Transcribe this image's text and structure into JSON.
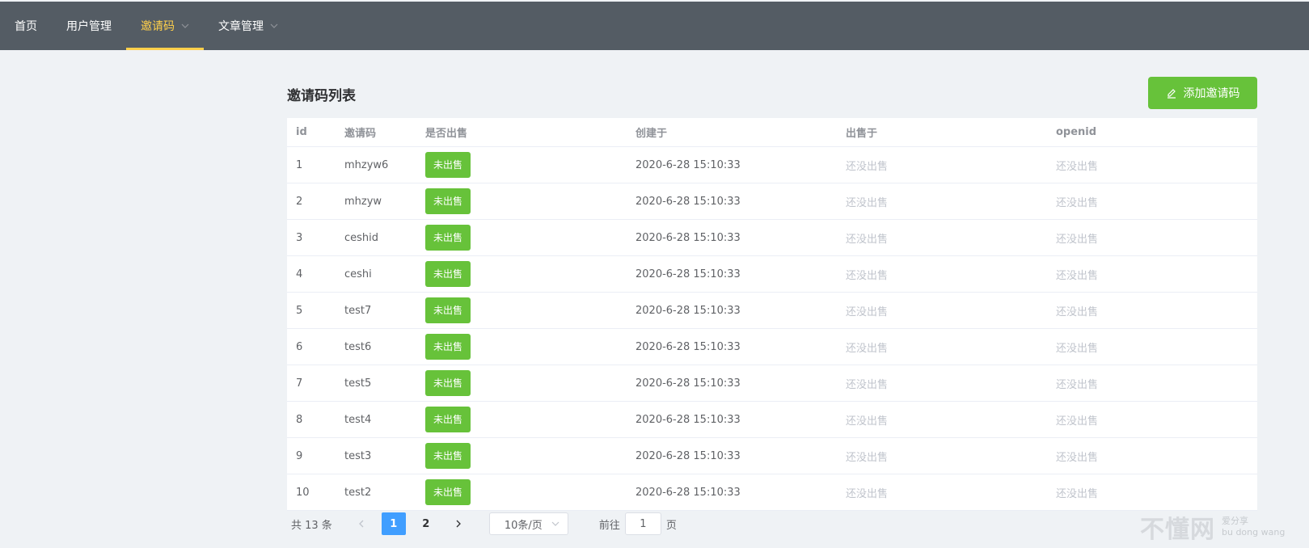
{
  "nav": {
    "items": [
      {
        "label": "首页",
        "active": false,
        "dropdown": false
      },
      {
        "label": "用户管理",
        "active": false,
        "dropdown": false
      },
      {
        "label": "邀请码",
        "active": true,
        "dropdown": true
      },
      {
        "label": "文章管理",
        "active": false,
        "dropdown": true
      }
    ]
  },
  "page": {
    "title": "邀请码列表",
    "add_button": "添加邀请码",
    "add_icon": "edit-icon"
  },
  "table": {
    "columns": [
      "id",
      "邀请码",
      "是否出售",
      "创建于",
      "出售于",
      "openid"
    ],
    "rows": [
      {
        "id": "1",
        "code": "mhzyw6",
        "status": "未出售",
        "created": "2020-6-28 15:10:33",
        "sold_at": "还没出售",
        "openid": "还没出售"
      },
      {
        "id": "2",
        "code": "mhzyw",
        "status": "未出售",
        "created": "2020-6-28 15:10:33",
        "sold_at": "还没出售",
        "openid": "还没出售"
      },
      {
        "id": "3",
        "code": "ceshid",
        "status": "未出售",
        "created": "2020-6-28 15:10:33",
        "sold_at": "还没出售",
        "openid": "还没出售"
      },
      {
        "id": "4",
        "code": "ceshi",
        "status": "未出售",
        "created": "2020-6-28 15:10:33",
        "sold_at": "还没出售",
        "openid": "还没出售"
      },
      {
        "id": "5",
        "code": "test7",
        "status": "未出售",
        "created": "2020-6-28 15:10:33",
        "sold_at": "还没出售",
        "openid": "还没出售"
      },
      {
        "id": "6",
        "code": "test6",
        "status": "未出售",
        "created": "2020-6-28 15:10:33",
        "sold_at": "还没出售",
        "openid": "还没出售"
      },
      {
        "id": "7",
        "code": "test5",
        "status": "未出售",
        "created": "2020-6-28 15:10:33",
        "sold_at": "还没出售",
        "openid": "还没出售"
      },
      {
        "id": "8",
        "code": "test4",
        "status": "未出售",
        "created": "2020-6-28 15:10:33",
        "sold_at": "还没出售",
        "openid": "还没出售"
      },
      {
        "id": "9",
        "code": "test3",
        "status": "未出售",
        "created": "2020-6-28 15:10:33",
        "sold_at": "还没出售",
        "openid": "还没出售"
      },
      {
        "id": "10",
        "code": "test2",
        "status": "未出售",
        "created": "2020-6-28 15:10:33",
        "sold_at": "还没出售",
        "openid": "还没出售"
      }
    ]
  },
  "pagination": {
    "total_text": "共 13 条",
    "pages": [
      "1",
      "2"
    ],
    "current": "1",
    "page_size": "10条/页",
    "goto_label": "前往",
    "goto_value": "1",
    "page_unit": "页"
  },
  "watermark": {
    "main": "不懂网",
    "sub1": "爱分享",
    "sub2": "bu dong wang"
  },
  "colors": {
    "topbar": "#545c64",
    "active": "#ffd04b",
    "success": "#67c23a",
    "primary": "#409eff"
  }
}
